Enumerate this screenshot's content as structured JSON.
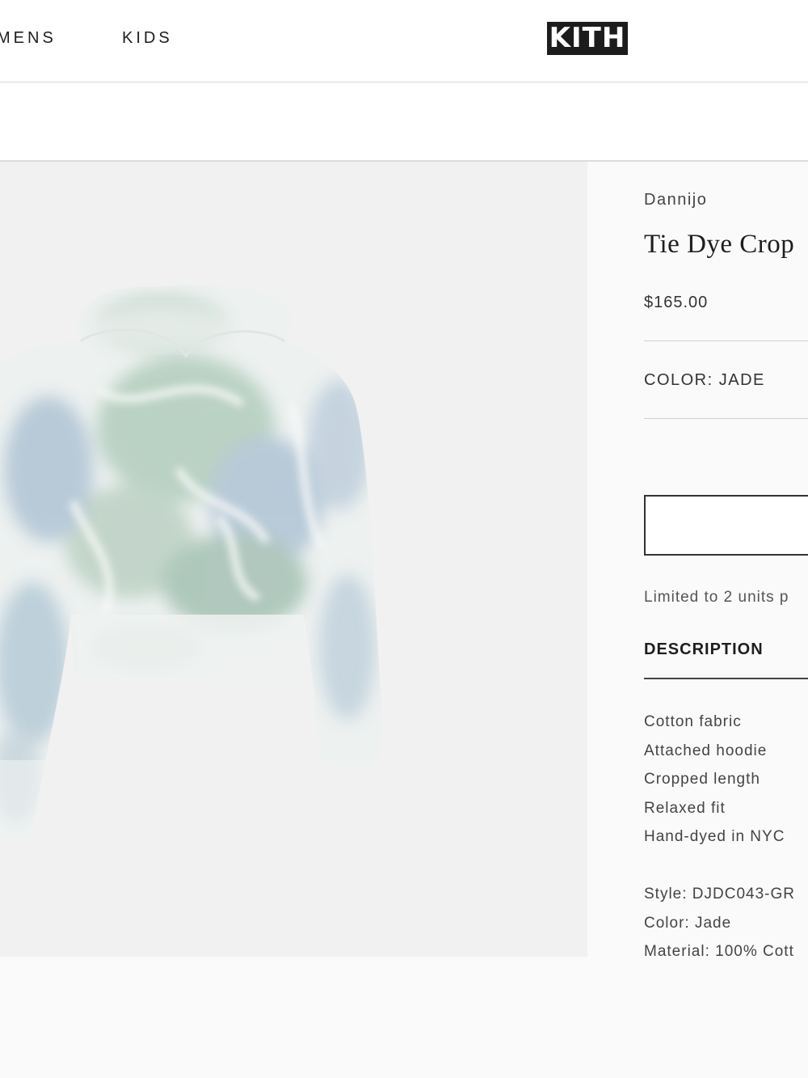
{
  "nav": {
    "links": [
      "MENS",
      "KIDS"
    ],
    "logo_text": "KITH"
  },
  "product": {
    "brand": "Dannijo",
    "title": "Tie Dye Crop",
    "price": "$165.00",
    "color_line": "COLOR: JADE",
    "limit_note": "Limited to 2 units p",
    "description_heading": "DESCRIPTION",
    "description_items": [
      "Cotton fabric",
      "Attached hoodie",
      "Cropped length",
      "Relaxed fit",
      "Hand-dyed in NYC"
    ],
    "specs": [
      "Style: DJDC043-GR",
      "Color: Jade",
      "Material: 100% Cott"
    ]
  },
  "colors": {
    "tie_dye_green": "#b5cfbf",
    "tie_dye_blue": "#b3c6d6",
    "gallery_bg": "#f1f1f1"
  }
}
